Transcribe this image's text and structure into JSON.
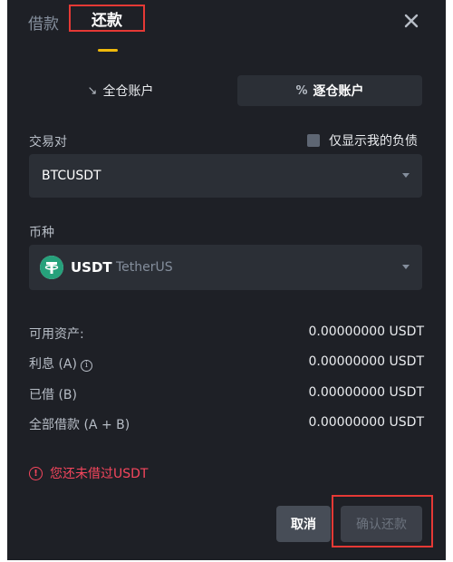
{
  "tabs": {
    "borrow": "借款",
    "repay": "还款"
  },
  "account_mode": {
    "cross": "全仓账户",
    "cross_glyph": "↘",
    "isolated": "逐仓账户",
    "isolated_glyph": "%"
  },
  "pair": {
    "label": "交易对",
    "value": "BTCUSDT"
  },
  "only_my_debt": {
    "label": "仅显示我的负债",
    "checked": false
  },
  "coin": {
    "label": "币种",
    "symbol": "USDT",
    "name": "TetherUS",
    "icon": "tether-icon"
  },
  "info": {
    "available_label": "可用资产:",
    "available_value": "0.00000000 USDT",
    "interest_label": "利息 (A)",
    "interest_value": "0.00000000 USDT",
    "borrowed_label": "已借 (B)",
    "borrowed_value": "0.00000000 USDT",
    "total_label": "全部借款 (A + B)",
    "total_value": "0.00000000 USDT"
  },
  "warning": {
    "text": "您还未借过USDT"
  },
  "actions": {
    "cancel": "取消",
    "confirm": "确认还款"
  },
  "colors": {
    "background": "#1e2026",
    "accent": "#f0b90b",
    "error": "#f6465d",
    "highlight_box": "#e53935"
  }
}
